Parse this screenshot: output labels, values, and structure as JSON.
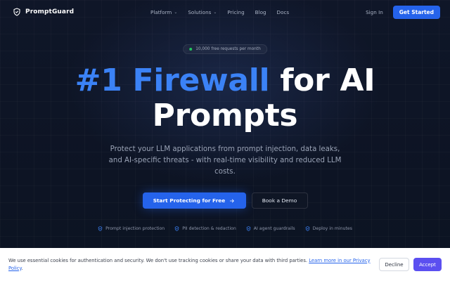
{
  "nav": {
    "brand": "PromptGuard",
    "brand_icon": "shield-icon",
    "menu": [
      {
        "label": "Platform",
        "has_dropdown": true
      },
      {
        "label": "Solutions",
        "has_dropdown": true
      },
      {
        "label": "Pricing",
        "has_dropdown": false
      },
      {
        "label": "Blog",
        "has_dropdown": false
      },
      {
        "label": "Docs",
        "has_dropdown": false
      }
    ],
    "sign_in": "Sign In",
    "get_started": "Get Started"
  },
  "hero": {
    "badge": "10,000 free requests per month",
    "headline_accent": "#1 Firewall",
    "headline_rest_1": "for AI",
    "headline_rest_2": "Prompts",
    "subtitle": "Protect your LLM applications from prompt injection, data leaks, and AI-specific threats - with real-time visibility and reduced LLM costs.",
    "primary_cta": "Start Protecting for Free",
    "primary_cta_icon": "arrow-right-icon",
    "secondary_cta": "Book a Demo",
    "features": [
      "Prompt injection protection",
      "PII detection & redaction",
      "AI agent guardrails",
      "Deploy in minutes"
    ]
  },
  "cookie": {
    "text": "We use essential cookies for authentication and security. We don't use tracking cookies or share your data with third parties.",
    "link": "Learn more in our Privacy Policy",
    "link_suffix": ".",
    "decline": "Decline",
    "accept": "Accept"
  },
  "colors": {
    "background": "#0d1424",
    "accent_blue": "#3b82f6",
    "primary_button": "#2563eb",
    "accept_button": "#5b4ff0",
    "status_dot": "#22c55e"
  }
}
